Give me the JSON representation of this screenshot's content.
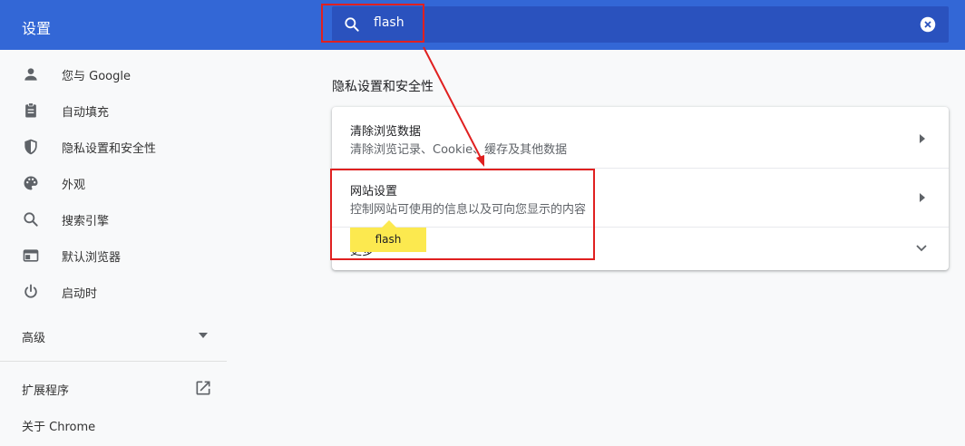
{
  "header": {
    "title": "设置",
    "search_value": "flash"
  },
  "sidebar": {
    "items": [
      {
        "label": "您与 Google",
        "icon": "person-icon"
      },
      {
        "label": "自动填充",
        "icon": "clipboard-icon"
      },
      {
        "label": "隐私设置和安全性",
        "icon": "shield-icon"
      },
      {
        "label": "外观",
        "icon": "palette-icon"
      },
      {
        "label": "搜索引擎",
        "icon": "search-icon"
      },
      {
        "label": "默认浏览器",
        "icon": "browser-window-icon"
      },
      {
        "label": "启动时",
        "icon": "power-icon"
      }
    ],
    "advanced_label": "高级",
    "extensions_label": "扩展程序",
    "about_label": "关于 Chrome"
  },
  "main": {
    "section_title": "隐私设置和安全性",
    "rows": [
      {
        "title": "清除浏览数据",
        "subtitle": "清除浏览记录、Cookie、缓存及其他数据"
      },
      {
        "title": "网站设置",
        "subtitle": "控制网站可使用的信息以及可向您显示的内容"
      }
    ],
    "collapsed_row_label": "更多"
  },
  "search_highlight": {
    "text": "flash",
    "color": "#fce94f"
  },
  "colors": {
    "header": "#3367d6",
    "search_box": "#2a52be",
    "annotation": "#e02020"
  }
}
